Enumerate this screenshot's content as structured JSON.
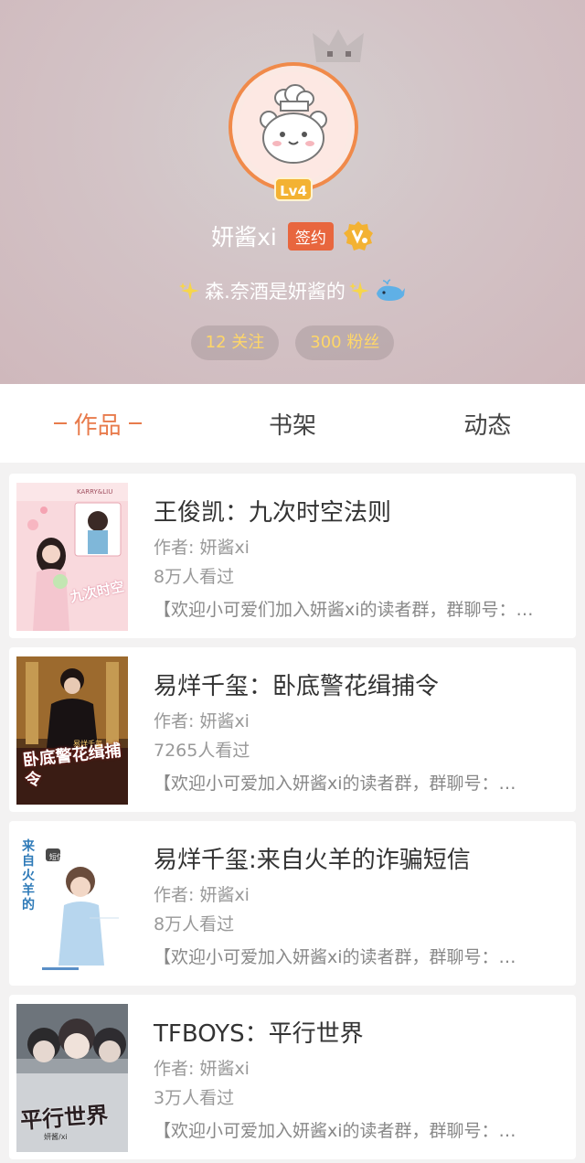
{
  "profile": {
    "level": "Lv4",
    "username": "妍酱xi",
    "sign_badge": "签约",
    "signature": "森.奈酒是妍酱的",
    "following": "12 关注",
    "followers": "300 粉丝"
  },
  "tabs": [
    {
      "label": "作品",
      "active": true
    },
    {
      "label": "书架",
      "active": false
    },
    {
      "label": "动态",
      "active": false
    }
  ],
  "books": [
    {
      "title": "王俊凯：九次时空法则",
      "author": "作者: 妍酱xi",
      "views": "8万人看过",
      "description": "【欢迎小可爱们加入妍酱xi的读者群，群聊号：…",
      "cover_text": "九次时空",
      "cover_label": "KARRY&LIU"
    },
    {
      "title": "易烊千玺：卧底警花缉捕令",
      "author": "作者: 妍酱xi",
      "views": "7265人看过",
      "description": "【欢迎小可爱加入妍酱xi的读者群，群聊号：…",
      "cover_text": "卧底警花缉捕令",
      "cover_label": "易烊千玺"
    },
    {
      "title": "易烊千玺:来自火羊的诈骗短信",
      "author": "作者: 妍酱xi",
      "views": "8万人看过",
      "description": "【欢迎小可爱加入妍酱xi的读者群，群聊号：…",
      "cover_text": "来自火羊的",
      "cover_label": "短信"
    },
    {
      "title": "TFBOYS：平行世界",
      "author": "作者: 妍酱xi",
      "views": "3万人看过",
      "description": "【欢迎小可爱加入妍酱xi的读者群，群聊号：…",
      "cover_text": "平行世界",
      "cover_label": "妍酱/xi"
    }
  ],
  "colors": {
    "accent": "#e87b4c",
    "level_badge": "#f3b233",
    "sign_badge": "#e8663e",
    "stat_text": "#ffd768"
  }
}
